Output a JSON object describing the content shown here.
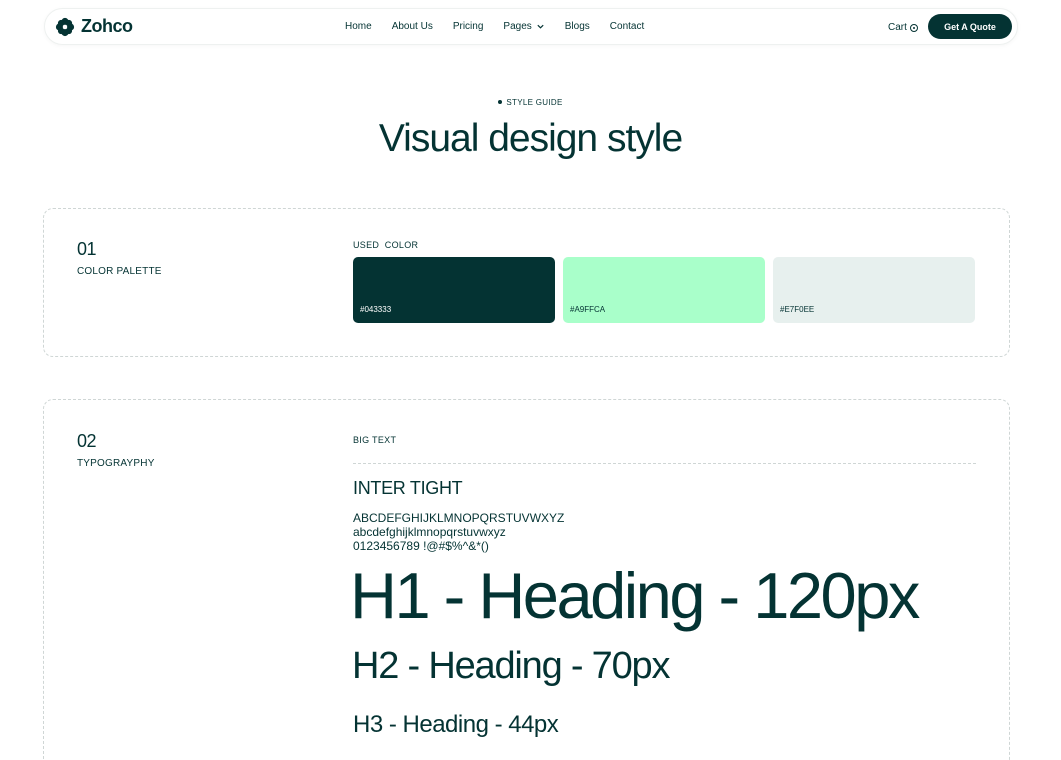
{
  "nav": {
    "brand": "Zohco",
    "items": [
      {
        "label": "Home"
      },
      {
        "label": "About Us"
      },
      {
        "label": "Pricing"
      },
      {
        "label": "Pages",
        "has_dropdown": true
      },
      {
        "label": "Blogs"
      },
      {
        "label": "Contact"
      }
    ],
    "cart_label": "Cart",
    "cta_label": "Get A Quote"
  },
  "hero": {
    "eyebrow": "STYLE GUIDE",
    "title": "Visual design style"
  },
  "color_section": {
    "number": "01",
    "label": "COLOR PALETTE",
    "heading": "USED  COLOR",
    "swatches": [
      {
        "hex": "#043333",
        "label": "#043333",
        "text_color": "#ffffff"
      },
      {
        "hex": "#A9FFCA",
        "label": "#A9FFCA",
        "text_color": "#043333"
      },
      {
        "hex": "#E7F0EE",
        "label": "#E7F0EE",
        "text_color": "#043333"
      }
    ]
  },
  "typography_section": {
    "number": "02",
    "label": "TYPOGRAYPHY",
    "heading": "BIG TEXT",
    "font_name": "INTER TIGHT",
    "uppercase": "ABCDEFGHIJKLMNOPQRSTUVWXYZ",
    "lowercase": "abcdefghijklmnopqrstuvwxyz",
    "digits": "0123456789 !@#$%^&*()",
    "h1": "H1 - Heading - 120px",
    "h2": "H2 - Heading - 70px",
    "h3": "H3 - Heading - 44px"
  },
  "colors": {
    "primary": "#043333",
    "accent": "#A9FFCA",
    "light": "#E7F0EE"
  },
  "icons": {
    "logo": "flower-logo-icon",
    "dropdown": "chevron-down-icon",
    "cart": "cart-icon"
  }
}
